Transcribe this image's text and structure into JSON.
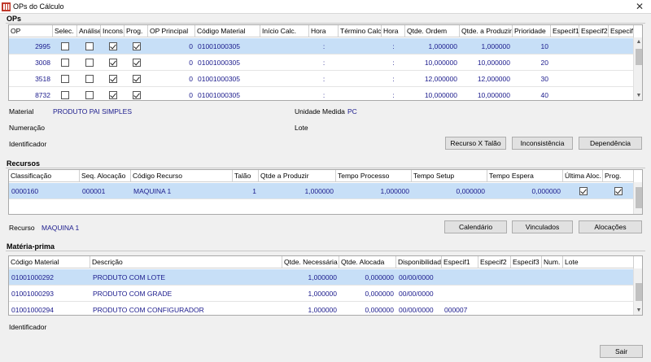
{
  "window": {
    "title": "OPs do Cálculo",
    "close_glyph": "✕"
  },
  "ops": {
    "section": "OPs",
    "headers": [
      "OP",
      "Selec.",
      "Análise",
      "Incons.",
      "Prog.",
      "OP Principal",
      "Código Material",
      "Início Calc.",
      "Hora",
      "Término Calc.",
      "Hora",
      "Qtde. Ordem",
      "Qtde. a Produzir",
      "Prioridade",
      "Especif1",
      "Especif2",
      "Especif3"
    ],
    "rows": [
      {
        "op": "2995",
        "selec": false,
        "analise": false,
        "incons": true,
        "prog": true,
        "op_principal": "0",
        "codigo": "01001000305",
        "hora1": ":",
        "hora2": ":",
        "qtde_ordem": "1,000000",
        "qtde_produzir": "1,000000",
        "prioridade": "10"
      },
      {
        "op": "3008",
        "selec": false,
        "analise": false,
        "incons": true,
        "prog": true,
        "op_principal": "0",
        "codigo": "01001000305",
        "hora1": ":",
        "hora2": ":",
        "qtde_ordem": "10,000000",
        "qtde_produzir": "10,000000",
        "prioridade": "20"
      },
      {
        "op": "3518",
        "selec": false,
        "analise": false,
        "incons": true,
        "prog": true,
        "op_principal": "0",
        "codigo": "01001000305",
        "hora1": ":",
        "hora2": ":",
        "qtde_ordem": "12,000000",
        "qtde_produzir": "12,000000",
        "prioridade": "30"
      },
      {
        "op": "8732",
        "selec": false,
        "analise": false,
        "incons": true,
        "prog": true,
        "op_principal": "0",
        "codigo": "01001000305",
        "hora1": ":",
        "hora2": ":",
        "qtde_ordem": "10,000000",
        "qtde_produzir": "10,000000",
        "prioridade": "40"
      }
    ],
    "material_label": "Material",
    "material_value": "PRODUTO PAI SIMPLES",
    "unidade_label": "Unidade Medida",
    "unidade_value": "PC",
    "numeracao_label": "Numeração",
    "lote_label": "Lote",
    "identificador_label": "Identificador",
    "buttons": {
      "recurso_talao": "Recurso X Talão",
      "inconsistencia": "Inconsistência",
      "dependencia": "Dependência"
    }
  },
  "recursos": {
    "section": "Recursos",
    "headers": [
      "Classificação",
      "Seq. Alocação",
      "Código Recurso",
      "Talão",
      "Qtde a Produzir",
      "Tempo Processo",
      "Tempo Setup",
      "Tempo Espera",
      "Última Aloc.",
      "Prog."
    ],
    "rows": [
      {
        "classificacao": "0000160",
        "seq": "000001",
        "codigo": "MAQUINA 1",
        "talao": "1",
        "qtde": "1,000000",
        "processo": "1,000000",
        "setup": "0,000000",
        "espera": "0,000000",
        "ultima": true,
        "prog": true
      }
    ],
    "recurso_label": "Recurso",
    "recurso_value": "MAQUINA 1",
    "buttons": {
      "calendario": "Calendário",
      "vinculados": "Vinculados",
      "alocacoes": "Alocações"
    }
  },
  "materia": {
    "section": "Matéria-prima",
    "headers": [
      "Código Material",
      "Descrição",
      "Qtde. Necessária",
      "Qtde. Alocada",
      "Disponibilidade",
      "Especif1",
      "Especif2",
      "Especif3",
      "Num.",
      "Lote"
    ],
    "rows": [
      {
        "codigo": "01001000292",
        "descricao": "PRODUTO COM LOTE",
        "necessaria": "1,000000",
        "alocada": "0,000000",
        "disponibilidade": "00/00/0000",
        "especif1": ""
      },
      {
        "codigo": "01001000293",
        "descricao": "PRODUTO COM GRADE",
        "necessaria": "1,000000",
        "alocada": "0,000000",
        "disponibilidade": "00/00/0000",
        "especif1": ""
      },
      {
        "codigo": "01001000294",
        "descricao": "PRODUTO COM CONFIGURADOR",
        "necessaria": "1,000000",
        "alocada": "0,000000",
        "disponibilidade": "00/00/0000",
        "especif1": "000007"
      }
    ],
    "identificador_label": "Identificador"
  },
  "footer": {
    "sair": "Sair"
  },
  "colors": {
    "selection": "#c7dff7",
    "value_text": "#1a1a8c",
    "button_bg": "#e1e1e1"
  }
}
